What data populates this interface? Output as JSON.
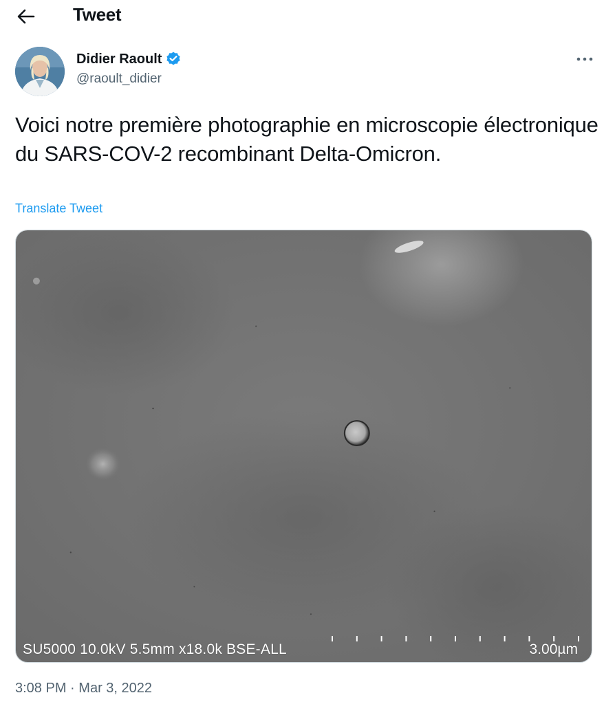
{
  "header": {
    "title": "Tweet",
    "back_icon": "arrow-left-icon"
  },
  "author": {
    "display_name": "Didier Raoult",
    "handle": "@raoult_didier",
    "verified_icon": "verified-badge-icon",
    "verified_color": "#1d9bf0",
    "more_icon": "more-horizontal-icon"
  },
  "tweet": {
    "text": "Voici notre première photographie en microscopie électronique du SARS-COV-2 recombinant Delta-Omicron.",
    "translate_label": "Translate Tweet"
  },
  "media": {
    "caption": "SU5000 10.0kV 5.5mm x18.0k BSE-ALL",
    "scale": "3.00µm"
  },
  "meta": {
    "time": "3:08 PM",
    "separator": "·",
    "date": "Mar 3, 2022"
  },
  "colors": {
    "accent": "#1d9bf0",
    "text": "#0f1419",
    "secondary": "#536471"
  }
}
